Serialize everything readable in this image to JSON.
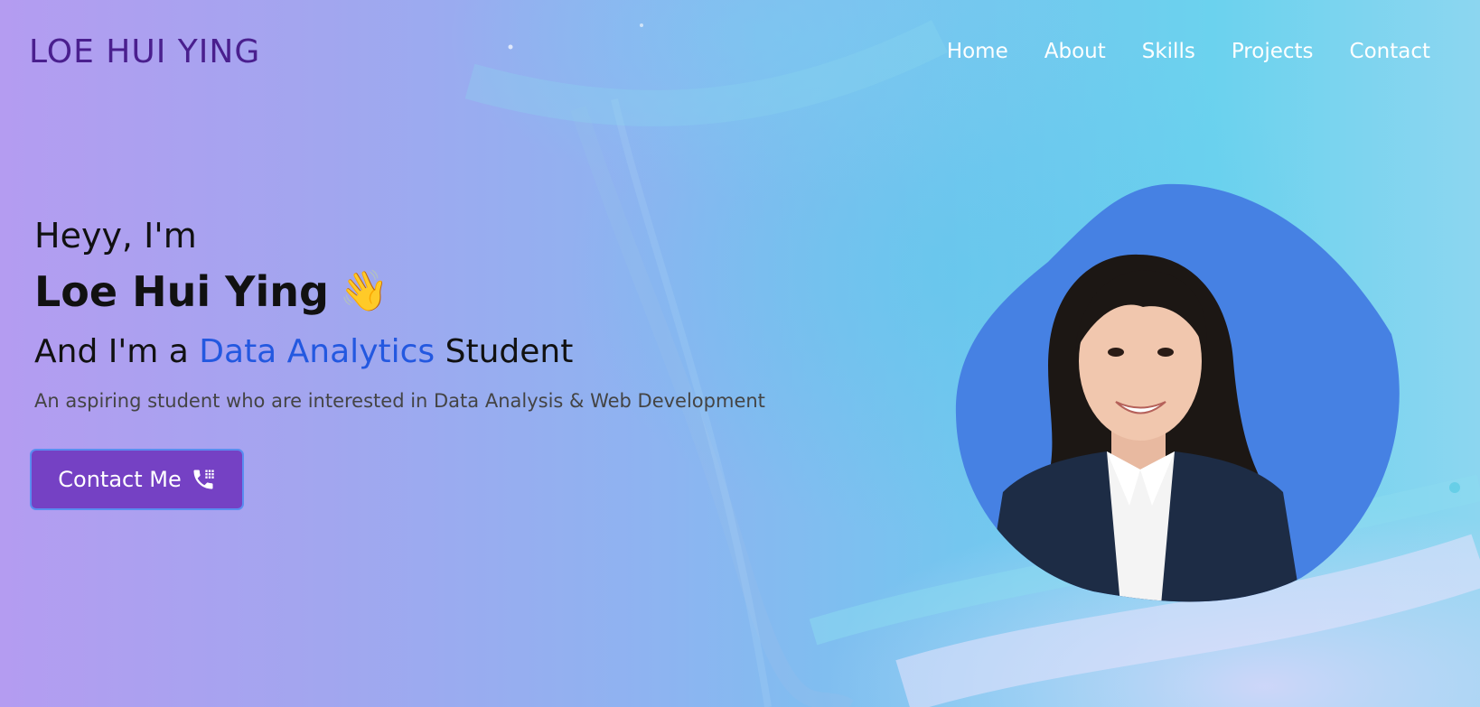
{
  "header": {
    "logo": "LOE HUI YING",
    "nav": [
      "Home",
      "About",
      "Skills",
      "Projects",
      "Contact"
    ]
  },
  "hero": {
    "greeting": "Heyy, I'm",
    "name": "Loe Hui Ying",
    "wave_emoji": "👋",
    "role_prefix": "And I'm a",
    "role_highlight": "Data Analytics",
    "role_suffix": "Student",
    "tagline": "An aspiring student who are interested in Data Analysis & Web Development",
    "cta_label": "Contact Me",
    "cta_icon": "phone-icon"
  },
  "portrait": {
    "icon": "profile-photo",
    "blob_color": "#4681e3",
    "jacket_color": "#1d2c45",
    "hair_color": "#1c1714"
  },
  "colors": {
    "logo": "#4a1f8e",
    "accent": "#2358e0",
    "button": "#7541c4",
    "button_border": "#5a8df0",
    "nav_text": "#ffffff"
  }
}
